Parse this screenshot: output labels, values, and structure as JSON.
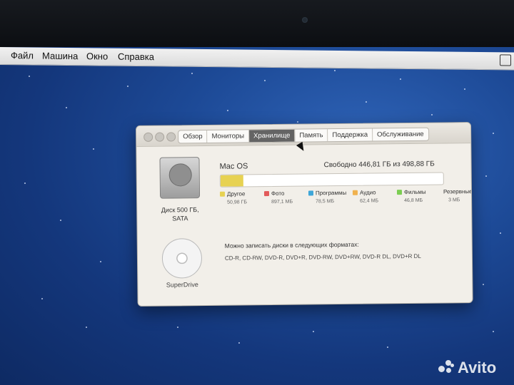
{
  "menubar": {
    "items": [
      "Файл",
      "Машина",
      "Окно",
      "Справка"
    ]
  },
  "window": {
    "tabs": [
      "Обзор",
      "Мониторы",
      "Хранилище",
      "Память",
      "Поддержка",
      "Обслуживание"
    ],
    "active_tab": "Хранилище",
    "disk": {
      "name": "Mac OS",
      "free": "Свободно 446,81 ГБ из 498,88 ГБ",
      "used_fraction": 0.104
    },
    "hdd_label_line1": "Диск 500 ГБ,",
    "hdd_label_line2": "SATA",
    "superdrive_label": "SuperDrive",
    "legend": [
      {
        "name": "Другое",
        "size": "50,98 ГБ",
        "color": "#e7d252"
      },
      {
        "name": "Фото",
        "size": "897,1 МБ",
        "color": "#e25a5a"
      },
      {
        "name": "Программы",
        "size": "78,5 МБ",
        "color": "#3ea6d8"
      },
      {
        "name": "Аудио",
        "size": "62,4 МБ",
        "color": "#f0b24f"
      },
      {
        "name": "Фильмы",
        "size": "46,8 МБ",
        "color": "#7ccd52"
      },
      {
        "name": "Резервные копии",
        "size": "3 МБ",
        "color": "#a98be0"
      }
    ],
    "formats_title": "Можно записать диски в следующих форматах:",
    "formats_list": "CD-R, CD-RW, DVD-R, DVD+R, DVD-RW, DVD+RW, DVD-R DL, DVD+R DL"
  },
  "watermark": {
    "text": "Avito"
  }
}
